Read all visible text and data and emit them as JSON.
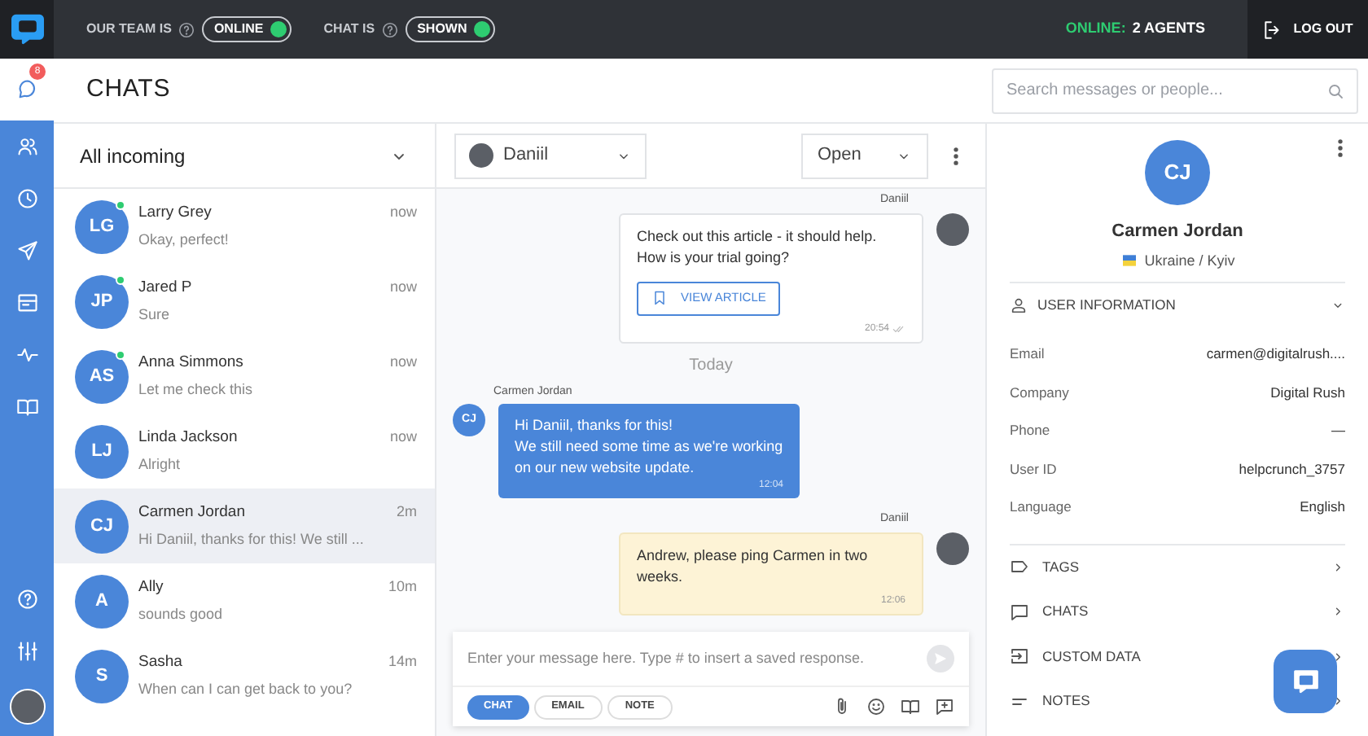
{
  "topbar": {
    "team_label": "OUR TEAM IS",
    "team_status": {
      "label": "ONLINE",
      "on": true
    },
    "chat_label": "CHAT IS",
    "chat_status": {
      "label": "SHOWN",
      "on": true
    },
    "online_label": "ONLINE:",
    "online_count": "2 AGENTS",
    "logout": "LOG OUT"
  },
  "sidebar": {
    "badge": "8",
    "items": [
      {
        "kind": "chats",
        "selected": true
      },
      {
        "kind": "contacts",
        "selected": false
      },
      {
        "kind": "history",
        "selected": false
      },
      {
        "kind": "send",
        "selected": false
      },
      {
        "kind": "inbox",
        "selected": false
      },
      {
        "kind": "activity",
        "selected": false
      },
      {
        "kind": "book",
        "selected": false
      }
    ],
    "bottom": [
      {
        "kind": "help"
      },
      {
        "kind": "settings"
      },
      {
        "kind": "avatar"
      }
    ]
  },
  "header": {
    "title": "CHATS",
    "search": {
      "placeholder": "Search messages or people..."
    }
  },
  "chat_list": {
    "filter": "All incoming",
    "items": [
      {
        "initials": "LG",
        "name": "Larry Grey",
        "time": "now",
        "preview": "Okay, perfect!",
        "online": true,
        "selected": false
      },
      {
        "initials": "JP",
        "name": "Jared P",
        "time": "now",
        "preview": "Sure",
        "online": true,
        "selected": false
      },
      {
        "initials": "AS",
        "name": "Anna Simmons",
        "time": "now",
        "preview": "Let me check this",
        "online": true,
        "selected": false
      },
      {
        "initials": "LJ",
        "name": "Linda Jackson",
        "time": "now",
        "preview": "Alright",
        "online": false,
        "selected": false
      },
      {
        "initials": "CJ",
        "name": "Carmen Jordan",
        "time": "2m",
        "preview": "Hi Daniil, thanks for this! We still ...",
        "online": false,
        "selected": true
      },
      {
        "initials": "A",
        "name": "Ally",
        "time": "10m",
        "preview": "sounds good",
        "online": false,
        "selected": false
      },
      {
        "initials": "S",
        "name": "Sasha",
        "time": "14m",
        "preview": "When can I can get back to you?",
        "online": false,
        "selected": false
      }
    ]
  },
  "conversation": {
    "assignee": "Daniil",
    "status": "Open",
    "messages": [
      {
        "kind": "agent",
        "author": "Daniil",
        "lines": [
          "Check out this article - it should help.",
          "How is your trial going?"
        ],
        "button": "VIEW ARTICLE",
        "time": "20:54",
        "read": true
      },
      {
        "kind": "divider",
        "label": "Today"
      },
      {
        "kind": "customer",
        "author": "Carmen Jordan",
        "initials": "CJ",
        "lines": [
          "Hi Daniil, thanks for this!",
          "We still need some time as we're working on our new website update."
        ],
        "time": "12:04"
      },
      {
        "kind": "note",
        "author": "Daniil",
        "lines": [
          "Andrew, please ping Carmen in two weeks."
        ],
        "time": "12:06"
      }
    ],
    "composer": {
      "placeholder": "Enter your message here. Type # to insert a saved response.",
      "modes": [
        {
          "label": "CHAT",
          "selected": true
        },
        {
          "label": "EMAIL",
          "selected": false
        },
        {
          "label": "NOTE",
          "selected": false
        }
      ]
    }
  },
  "profile": {
    "initials": "CJ",
    "name": "Carmen Jordan",
    "location": "Ukraine / Kyiv",
    "section": "USER INFORMATION",
    "fields": [
      {
        "label": "Email",
        "value": "carmen@digitalrush...."
      },
      {
        "label": "Company",
        "value": "Digital Rush"
      },
      {
        "label": "Phone",
        "value": "—"
      },
      {
        "label": "User ID",
        "value": "helpcrunch_3757"
      },
      {
        "label": "Language",
        "value": "English"
      }
    ],
    "sections": [
      {
        "kind": "tag",
        "label": "TAGS"
      },
      {
        "kind": "chat",
        "label": "CHATS"
      },
      {
        "kind": "import",
        "label": "CUSTOM DATA"
      },
      {
        "kind": "notes",
        "label": "NOTES"
      }
    ]
  }
}
